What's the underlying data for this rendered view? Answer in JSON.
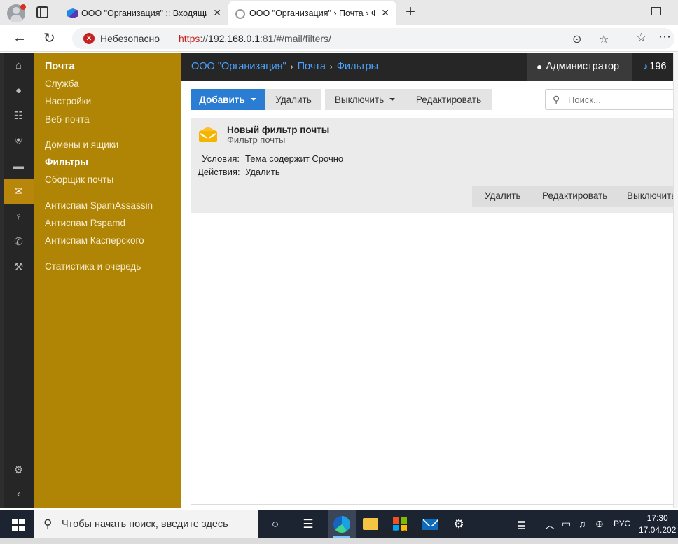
{
  "browser": {
    "tabs": [
      {
        "title": "ООО \"Организация\" :: Входящие",
        "active": false
      },
      {
        "title": "ООО \"Организация\" › Почта › Фильтры",
        "active": true
      }
    ],
    "security_label": "Небезопасно",
    "url": {
      "scheme": "https",
      "rest": "://",
      "host": "192.168.0.1",
      "path": ":81/#/mail/filters/"
    },
    "colors": {
      "insecure": "#c5221f"
    }
  },
  "app": {
    "icon_bar": [
      {
        "name": "home-icon",
        "glyph": "⌂"
      },
      {
        "name": "user-icon",
        "glyph": "👤"
      },
      {
        "name": "sitemap-icon",
        "glyph": "☷"
      },
      {
        "name": "shield-icon",
        "glyph": "⛨"
      },
      {
        "name": "folder-icon",
        "glyph": "▬"
      },
      {
        "name": "envelope-icon",
        "glyph": "✉"
      },
      {
        "name": "lightbulb-icon",
        "glyph": "💡"
      },
      {
        "name": "phone-icon",
        "glyph": "✆"
      },
      {
        "name": "wrench-icon",
        "glyph": "🔧"
      }
    ],
    "bottom_icons": [
      {
        "name": "gear-icon",
        "glyph": "⚙"
      },
      {
        "name": "collapse-icon",
        "glyph": "‹"
      }
    ],
    "menu": {
      "header": "Почта",
      "items": [
        "Служба",
        "Настройки",
        "Веб-почта",
        "Домены и ящики",
        "Фильтры",
        "Сборщик почты",
        "Антиспам SpamAssassin",
        "Антиспам Rspamd",
        "Антиспам Касперского",
        "Статистика и очередь"
      ],
      "current": "Фильтры"
    },
    "breadcrumbs": [
      "ООО \"Организация\"",
      "Почта",
      "Фильтры"
    ],
    "user": "Администратор",
    "notifications": "196",
    "colors": {
      "accent": "#b08506",
      "primary": "#2b7cd3",
      "dark": "#262626"
    }
  },
  "toolbar": {
    "add_label": "Добавить",
    "delete_label": "Удалить",
    "disable_label": "Выключить",
    "edit_label": "Редактировать",
    "search_placeholder": "Поиск..."
  },
  "filter": {
    "title": "Новый фильтр почты",
    "subtitle": "Фильтр почты",
    "conditions_label": "Условия:",
    "conditions_value": "Тема содержит Срочно",
    "actions_label": "Действия:",
    "actions_value": "Удалить",
    "buttons": {
      "delete": "Удалить",
      "edit": "Редактировать",
      "disable": "Выключить"
    }
  },
  "taskbar": {
    "search_text": "Чтобы начать поиск, введите здесь",
    "language": "РУС",
    "time": "17:30",
    "date": "17.04.202",
    "overlay_text": "Состояние сети"
  }
}
